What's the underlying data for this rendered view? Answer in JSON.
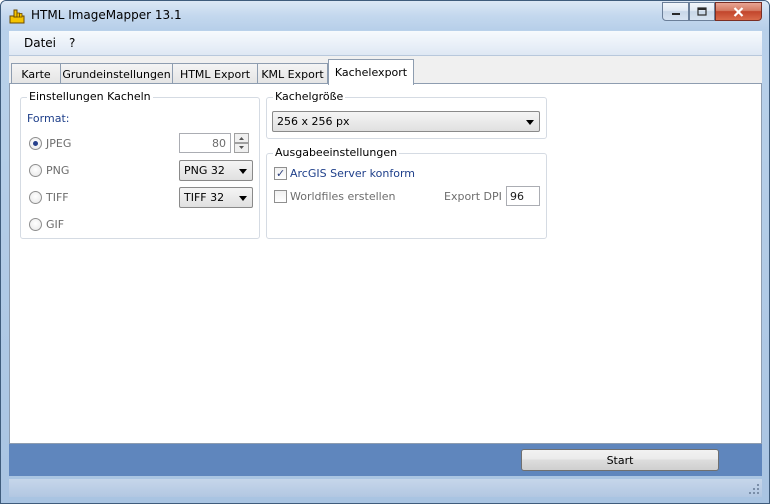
{
  "window": {
    "title": "HTML ImageMapper 13.1"
  },
  "menu": {
    "items": [
      {
        "label": "Datei"
      },
      {
        "label": "?"
      }
    ]
  },
  "tabs": [
    {
      "label": "Karte"
    },
    {
      "label": "Grundeinstellungen"
    },
    {
      "label": "HTML Export"
    },
    {
      "label": "KML Export"
    },
    {
      "label": "Kachelexport",
      "active": true
    }
  ],
  "tiles_settings": {
    "group_title": "Einstellungen Kacheln",
    "format_label": "Format:",
    "options": [
      {
        "label": "JPEG",
        "checked": true,
        "value": "80"
      },
      {
        "label": "PNG",
        "checked": false,
        "value": "PNG 32"
      },
      {
        "label": "TIFF",
        "checked": false,
        "value": "TIFF 32"
      },
      {
        "label": "GIF",
        "checked": false
      }
    ]
  },
  "tile_size": {
    "group_title": "Kachelgröße",
    "value": "256 x 256 px"
  },
  "output_settings": {
    "group_title": "Ausgabeeinstellungen",
    "arcgis_label": "ArcGIS Server konform",
    "arcgis_checked": true,
    "worldfiles_label": "Worldfiles erstellen",
    "worldfiles_checked": false,
    "dpi_label": "Export DPI",
    "dpi_value": "96"
  },
  "footer": {
    "start_label": "Start"
  },
  "colors": {
    "accent": "#5f86bd",
    "title_bar": "#c4d8ee",
    "close_button": "#c2452c"
  }
}
